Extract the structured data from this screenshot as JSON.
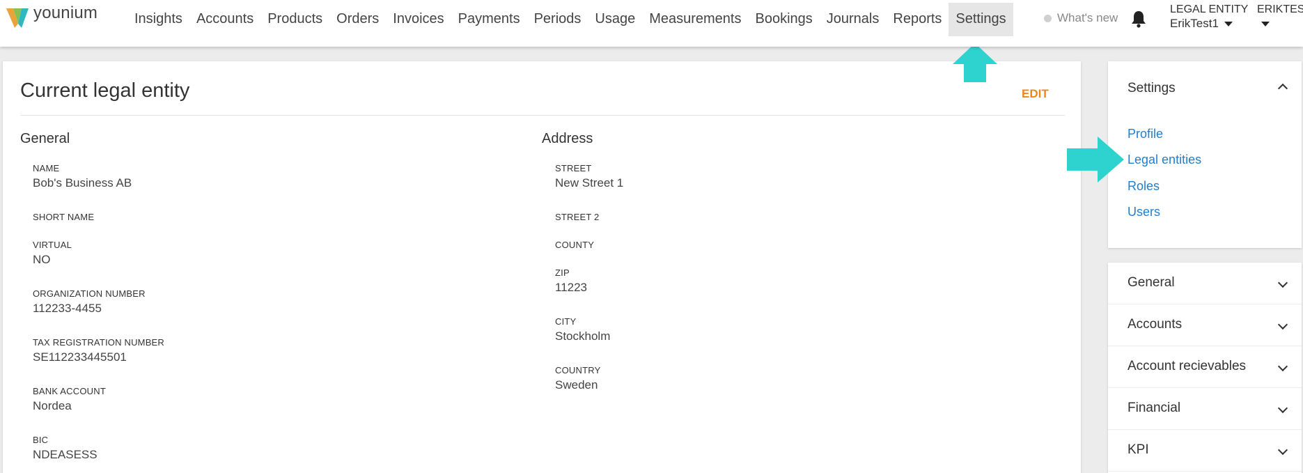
{
  "app": {
    "brand": "younium",
    "logo_colors": [
      "#e8a33a",
      "#84c054",
      "#2fb8c0"
    ]
  },
  "nav": {
    "items": [
      {
        "label": "Insights"
      },
      {
        "label": "Accounts"
      },
      {
        "label": "Products"
      },
      {
        "label": "Orders"
      },
      {
        "label": "Invoices"
      },
      {
        "label": "Payments"
      },
      {
        "label": "Periods"
      },
      {
        "label": "Usage"
      },
      {
        "label": "Measurements"
      },
      {
        "label": "Bookings"
      },
      {
        "label": "Journals"
      },
      {
        "label": "Reports"
      },
      {
        "label": "Settings",
        "active": true
      }
    ],
    "whats_new": "What's new",
    "legal_entity_label": "LEGAL ENTITY",
    "legal_entity_value": "ErikTest1",
    "user_name": "ERIKTEST"
  },
  "card": {
    "title": "Current legal entity",
    "edit_label": "EDIT",
    "general": {
      "title": "General",
      "fields": [
        {
          "label": "NAME",
          "value": "Bob's Business AB"
        },
        {
          "label": "SHORT NAME",
          "value": ""
        },
        {
          "label": "VIRTUAL",
          "value": "NO"
        },
        {
          "label": "ORGANIZATION NUMBER",
          "value": "112233-4455"
        },
        {
          "label": "TAX REGISTRATION NUMBER",
          "value": "SE112233445501"
        },
        {
          "label": "BANK ACCOUNT",
          "value": "Nordea"
        },
        {
          "label": "BIC",
          "value": "NDEASESS"
        }
      ]
    },
    "address": {
      "title": "Address",
      "fields": [
        {
          "label": "STREET",
          "value": "New Street 1"
        },
        {
          "label": "STREET 2",
          "value": ""
        },
        {
          "label": "COUNTY",
          "value": ""
        },
        {
          "label": "ZIP",
          "value": "11223"
        },
        {
          "label": "CITY",
          "value": "Stockholm"
        },
        {
          "label": "COUNTRY",
          "value": "Sweden"
        }
      ]
    }
  },
  "sidebar": {
    "settings_title": "Settings",
    "links": [
      "Profile",
      "Legal entities",
      "Roles",
      "Users"
    ],
    "groups": [
      "General",
      "Accounts",
      "Account recievables",
      "Financial",
      "KPI"
    ]
  },
  "colors": {
    "accent_edit": "#e8881f",
    "link": "#1f7fd0",
    "highlight_arrow": "#2ed3cf"
  }
}
